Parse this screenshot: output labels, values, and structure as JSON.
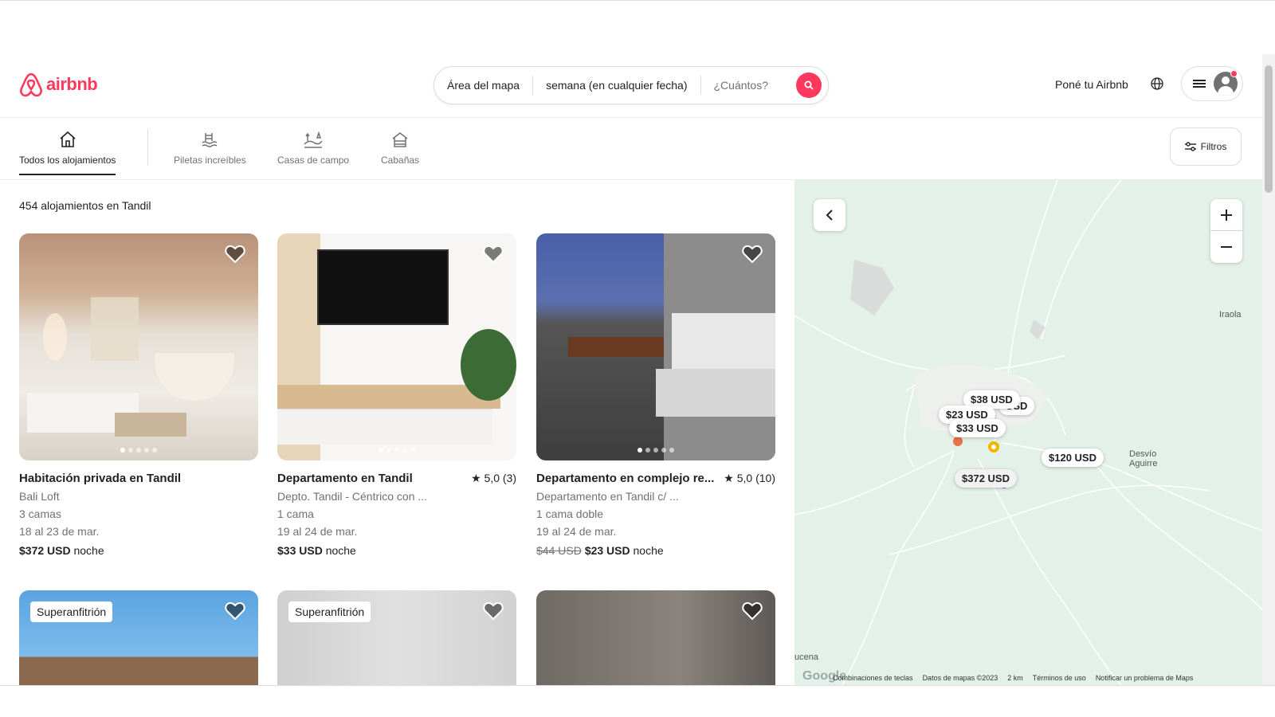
{
  "header": {
    "brand": "airbnb",
    "search": {
      "location": "Área del mapa",
      "dates": "semana (en cualquier fecha)",
      "guests": "¿Cuántos?"
    },
    "host_link": "Poné tu Airbnb"
  },
  "categories": [
    {
      "label": "Todos los alojamientos",
      "icon": "house-icon",
      "active": true
    },
    {
      "label": "Piletas increíbles",
      "icon": "pool-icon",
      "active": false
    },
    {
      "label": "Casas de campo",
      "icon": "countryside-icon",
      "active": false
    },
    {
      "label": "Cabañas",
      "icon": "cabin-icon",
      "active": false
    }
  ],
  "filters_label": "Filtros",
  "results_count": "454 alojamientos en Tandil",
  "listings": [
    {
      "title": "Habitación privada en Tandil",
      "rating": "",
      "line1": "Bali Loft",
      "line2": "3 camas",
      "dates": "18 al 23 de mar.",
      "old_price": "",
      "price": "$372 USD",
      "unit": "noche"
    },
    {
      "title": "Departamento en Tandil",
      "rating": "★ 5,0 (3)",
      "line1": "Depto. Tandil - Céntrico con ...",
      "line2": "1 cama",
      "dates": "19 al 24 de mar.",
      "old_price": "",
      "price": "$33 USD",
      "unit": "noche"
    },
    {
      "title": "Departamento en complejo re...",
      "rating": "★ 5,0 (10)",
      "line1": "Departamento en Tandil c/ ...",
      "line2": "1 cama doble",
      "dates": "19 al 24 de mar.",
      "old_price": "$44 USD",
      "price": "$23 USD",
      "unit": "noche"
    }
  ],
  "listings_row2": [
    {
      "badge": "Superanfitrión"
    },
    {
      "badge": "Superanfitrión"
    },
    {
      "badge": ""
    }
  ],
  "map": {
    "pins": [
      "$38 USD",
      "$23 USD",
      "$33 USD",
      "$120 USD",
      "$372 USD"
    ],
    "places": [
      "Iraola",
      "Desvío Aguirre",
      "ucena"
    ],
    "footer": [
      "Combinaciones de teclas",
      "Datos de mapas ©2023",
      "2 km",
      "Términos de uso",
      "Notificar un problema de Maps"
    ],
    "google": "Google"
  },
  "colors": {
    "brand": "#FF385C",
    "map_bg": "#e3f1e8"
  }
}
